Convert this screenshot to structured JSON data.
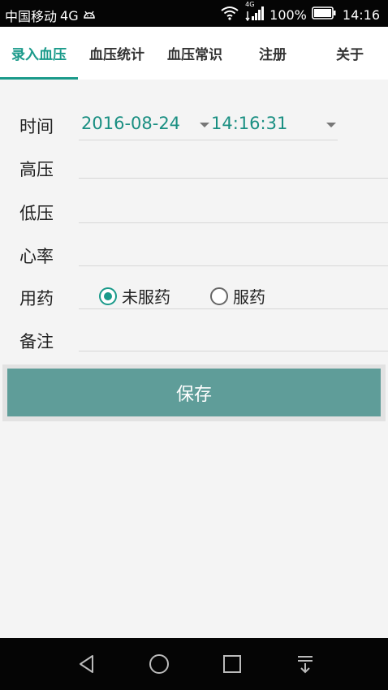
{
  "status_bar": {
    "carrier": "中国移动",
    "network": "4G",
    "signal_label": "4G",
    "battery": "100%",
    "time": "14:16",
    "icons": [
      "android-icon",
      "wifi-icon",
      "signal-icon",
      "battery-icon"
    ]
  },
  "tabs": [
    {
      "label": "录入血压",
      "active": true
    },
    {
      "label": "血压统计",
      "active": false
    },
    {
      "label": "血压常识",
      "active": false
    },
    {
      "label": "注册",
      "active": false
    },
    {
      "label": "关于",
      "active": false
    }
  ],
  "form": {
    "time_label": "时间",
    "date_value": "2016-08-24",
    "time_value": "14:16:31",
    "high_label": "高压",
    "high_value": "",
    "low_label": "低压",
    "low_value": "",
    "heart_rate_label": "心率",
    "heart_rate_value": "",
    "medication_label": "用药",
    "medication_options": [
      {
        "label": "未服药",
        "checked": true
      },
      {
        "label": "服药",
        "checked": false
      }
    ],
    "note_label": "备注",
    "note_value": ""
  },
  "save_label": "保存",
  "nav_bar": {
    "icons": [
      "back-icon",
      "home-icon",
      "recent-apps-icon",
      "notifications-icon"
    ]
  },
  "colors": {
    "accent": "#1a9a8a",
    "save_button": "#5f9d99",
    "status_bar": "#050505"
  }
}
